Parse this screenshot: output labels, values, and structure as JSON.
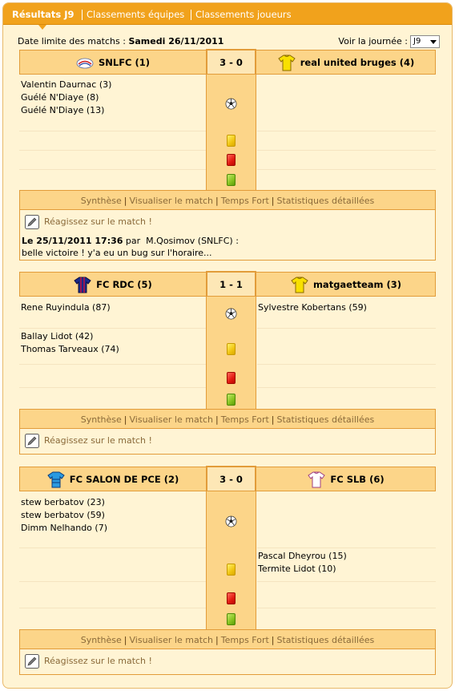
{
  "tabs": [
    {
      "label": "Résultats J9",
      "active": true
    },
    {
      "label": "Classements équipes",
      "active": false
    },
    {
      "label": "Classements joueurs",
      "active": false
    }
  ],
  "topbar": {
    "deadline_label": "Date limite des matchs :",
    "deadline_value": "Samedi 26/11/2011",
    "journee_label": "Voir la journée :",
    "journee_value": "J9"
  },
  "links": {
    "synthese": "Synthèse",
    "visualiser": "Visualiser le match",
    "temps_fort": "Temps Fort",
    "stats": "Statistiques détaillées"
  },
  "react_label": "Réagissez sur le match !",
  "colors": {
    "accent": "#f1a21c",
    "panel": "#fcd589",
    "background": "#fff4d4",
    "border": "#e29c3a"
  },
  "matches": [
    {
      "home": {
        "name": "SNLFC (1)",
        "icon": "snlfc-logo-icon"
      },
      "away": {
        "name": "real united bruges (4)",
        "icon": "yellow-jersey-icon"
      },
      "score": "3 - 0",
      "home_goals": [
        "Valentin Daurnac (3)",
        "Guélé N'Diaye (8)",
        "Guélé N'Diaye (13)"
      ],
      "away_goals": [],
      "home_yellow": [],
      "away_yellow": [],
      "comment": {
        "date": "Le 25/11/2011 17:36",
        "by": "par",
        "author": "M.Qosimov (SNLFC) :",
        "text": "belle victoire ! y'a eu un bug sur l'horaire..."
      }
    },
    {
      "home": {
        "name": "FC RDC (5)",
        "icon": "navy-striped-jersey-icon"
      },
      "away": {
        "name": "matgaetteam (3)",
        "icon": "yellow-jersey-icon"
      },
      "score": "1 - 1",
      "home_goals": [
        "Rene Ruyindula (87)"
      ],
      "away_goals": [
        "Sylvestre Kobertans (59)"
      ],
      "home_yellow": [
        "Ballay Lidot (42)",
        "Thomas Tarveaux (74)"
      ],
      "away_yellow": []
    },
    {
      "home": {
        "name": "FC SALON DE PCE (2)",
        "icon": "blue-jersey-icon"
      },
      "away": {
        "name": "FC SLB (6)",
        "icon": "white-jersey-icon"
      },
      "score": "3 - 0",
      "home_goals": [
        "stew berbatov (23)",
        "stew berbatov (59)",
        "Dimm Nelhando (7)"
      ],
      "away_goals": [],
      "home_yellow": [],
      "away_yellow": [
        "Pascal Dheyrou (15)",
        "Termite Lidot (10)"
      ]
    }
  ]
}
